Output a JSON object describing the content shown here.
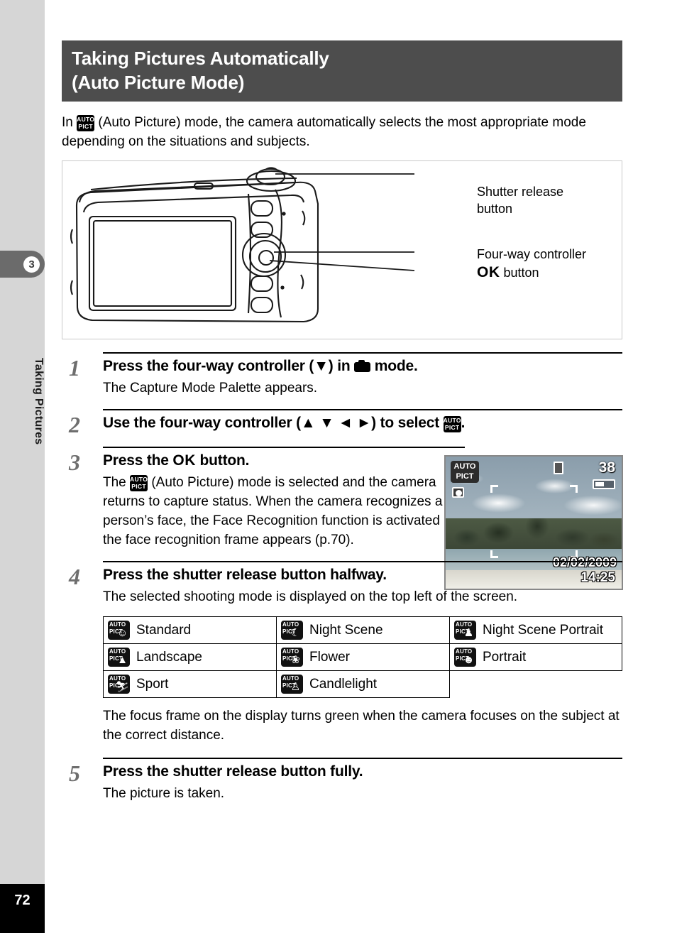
{
  "sidebar": {
    "chapter_number": "3",
    "chapter_title": "Taking Pictures",
    "page_number": "72"
  },
  "header": {
    "title_line1": "Taking Pictures Automatically",
    "title_line2": "(Auto Picture Mode)"
  },
  "intro": {
    "before_icon": "In",
    "icon": "auto-pict-icon",
    "icon_top": "AUTO",
    "icon_bottom": "PICT",
    "after_icon": "(Auto Picture) mode, the camera automatically selects the most appropriate mode depending on the situations and subjects."
  },
  "figure": {
    "callouts": [
      {
        "label": "Shutter release\nbutton",
        "name": "shutter-release-callout"
      },
      {
        "label": "Four-way controller",
        "name": "four-way-controller-callout"
      },
      {
        "label": "OK  button",
        "name": "ok-button-callout"
      }
    ]
  },
  "steps": [
    {
      "number": "1",
      "title_a": "Press the four-way controller (",
      "title_arrow": "▼",
      "title_b": ") in",
      "title_icon": "camera-icon",
      "title_c": "mode.",
      "desc": "The Capture Mode Palette appears."
    },
    {
      "number": "2",
      "title_a": "Use the four-way controller (",
      "title_arrows": "▲ ▼ ◄ ►",
      "title_b": ") to select",
      "title_icon": "auto-pict-icon",
      "title_c": "."
    },
    {
      "number": "3",
      "title_a": "Press the",
      "title_ok": "OK",
      "title_c": "button.",
      "desc_a": "The",
      "desc_icon": "auto-pict-icon",
      "desc_b": "(Auto Picture) mode is selected and the camera returns to capture status. When the camera recognizes a person’s face, the Face Recognition function is activated and the face recognition frame appears (p.70)."
    },
    {
      "number": "4",
      "title": "Press the shutter release button halfway.",
      "desc": "The selected shooting mode is displayed on the top left of the screen.",
      "desc2": "The focus frame on the display turns green when the camera focuses on the subject at the correct distance."
    },
    {
      "number": "5",
      "title": "Press the shutter release button fully.",
      "desc": "The picture is taken."
    }
  ],
  "lcd_preview": {
    "mode_badge_top": "AUTO",
    "mode_badge_bottom": "PICT",
    "shots_remaining": "38",
    "date": "02/02/2009",
    "time": "14:25",
    "face_icon": "face-detection-icon",
    "card_icon": "memory-card-icon",
    "battery_icon": "battery-icon"
  },
  "mode_table": {
    "rows": [
      [
        {
          "label": "Standard",
          "sym": "☺"
        },
        {
          "label": "Night Scene",
          "sym": "☾"
        },
        {
          "label": "Night Scene Portrait",
          "sym": "♟"
        }
      ],
      [
        {
          "label": "Landscape",
          "sym": "▲"
        },
        {
          "label": "Flower",
          "sym": "❀"
        },
        {
          "label": "Portrait",
          "sym": "☻"
        }
      ],
      [
        {
          "label": "Sport",
          "sym": "⛷"
        },
        {
          "label": "Candlelight",
          "sym": "♙"
        },
        {
          "label": "",
          "sym": ""
        }
      ]
    ],
    "icon_top": "AUTO",
    "icon_bottom": "PICT"
  }
}
